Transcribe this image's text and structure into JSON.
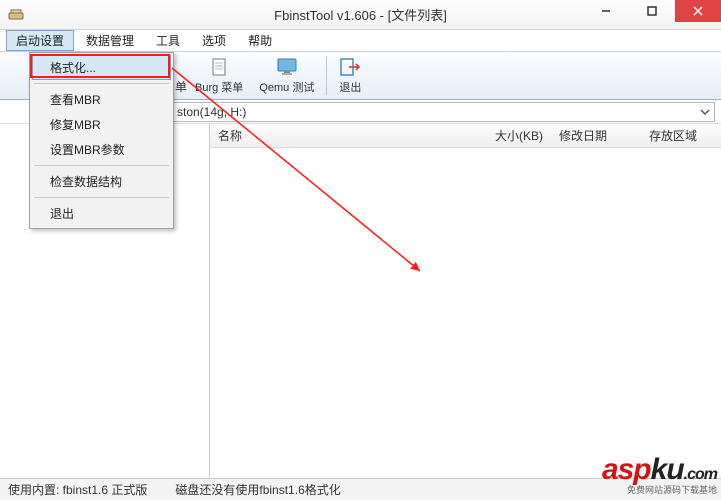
{
  "title": "FbinstTool v1.606 - [文件列表]",
  "menubar": [
    "启动设置",
    "数据管理",
    "工具",
    "选项",
    "帮助"
  ],
  "toolbar": {
    "burg": {
      "label": "Burg 菜单"
    },
    "qemu": {
      "label": "Qemu 测试"
    },
    "exit": {
      "label": "退出"
    },
    "hidden_suffix": "单"
  },
  "pathbar": {
    "value": "ston(14g, H:)"
  },
  "columns": {
    "name": "名称",
    "size": "大小(KB)",
    "date": "修改日期",
    "area": "存放区域"
  },
  "dropdown": {
    "items": [
      "格式化...",
      "查看MBR",
      "修复MBR",
      "设置MBR参数",
      "检查数据结构",
      "退出"
    ]
  },
  "statusbar": {
    "left": "使用内置: fbinst1.6 正式版",
    "right": "磁盘还没有使用fbinst1.6格式化"
  },
  "watermark": {
    "part1": "asp",
    "part2": "ku",
    "suffix": ".com",
    "sub": "免费网站源码下载基地"
  }
}
